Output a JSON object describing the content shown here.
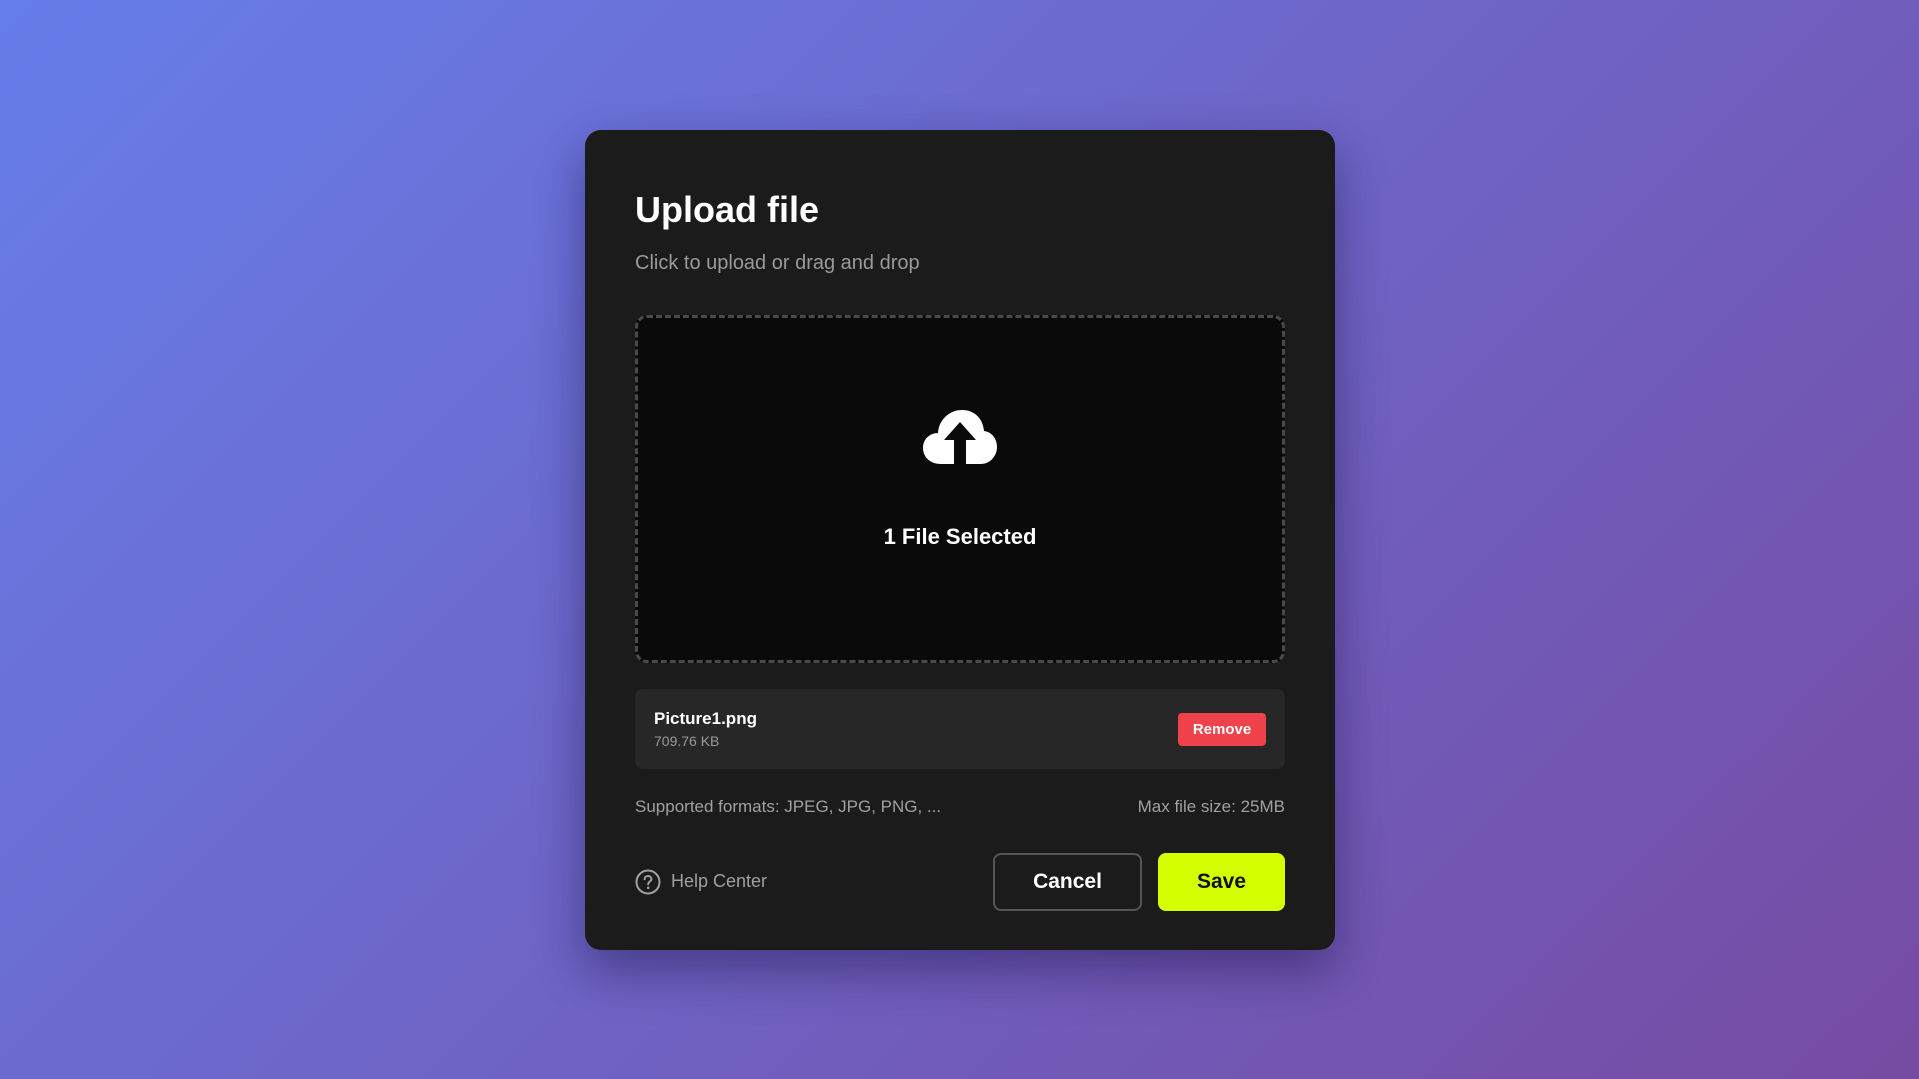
{
  "dialog": {
    "title": "Upload file",
    "subtitle": "Click to upload or drag and drop"
  },
  "dropzone": {
    "icon": "cloud-upload-icon",
    "status_text": "1 File Selected"
  },
  "file": {
    "name": "Picture1.png",
    "size": "709.76 KB",
    "remove_label": "Remove"
  },
  "info": {
    "formats": "Supported formats: JPEG, JPG, PNG, ...",
    "max_size": "Max file size: 25MB"
  },
  "footer": {
    "help_icon": "question-circle-icon",
    "help_label": "Help Center",
    "cancel_label": "Cancel",
    "save_label": "Save"
  },
  "colors": {
    "accent": "#d4ff00",
    "danger": "#f0424a",
    "dialog_bg": "#1b1b1b",
    "background_start": "#667eea",
    "background_end": "#764ba2"
  }
}
